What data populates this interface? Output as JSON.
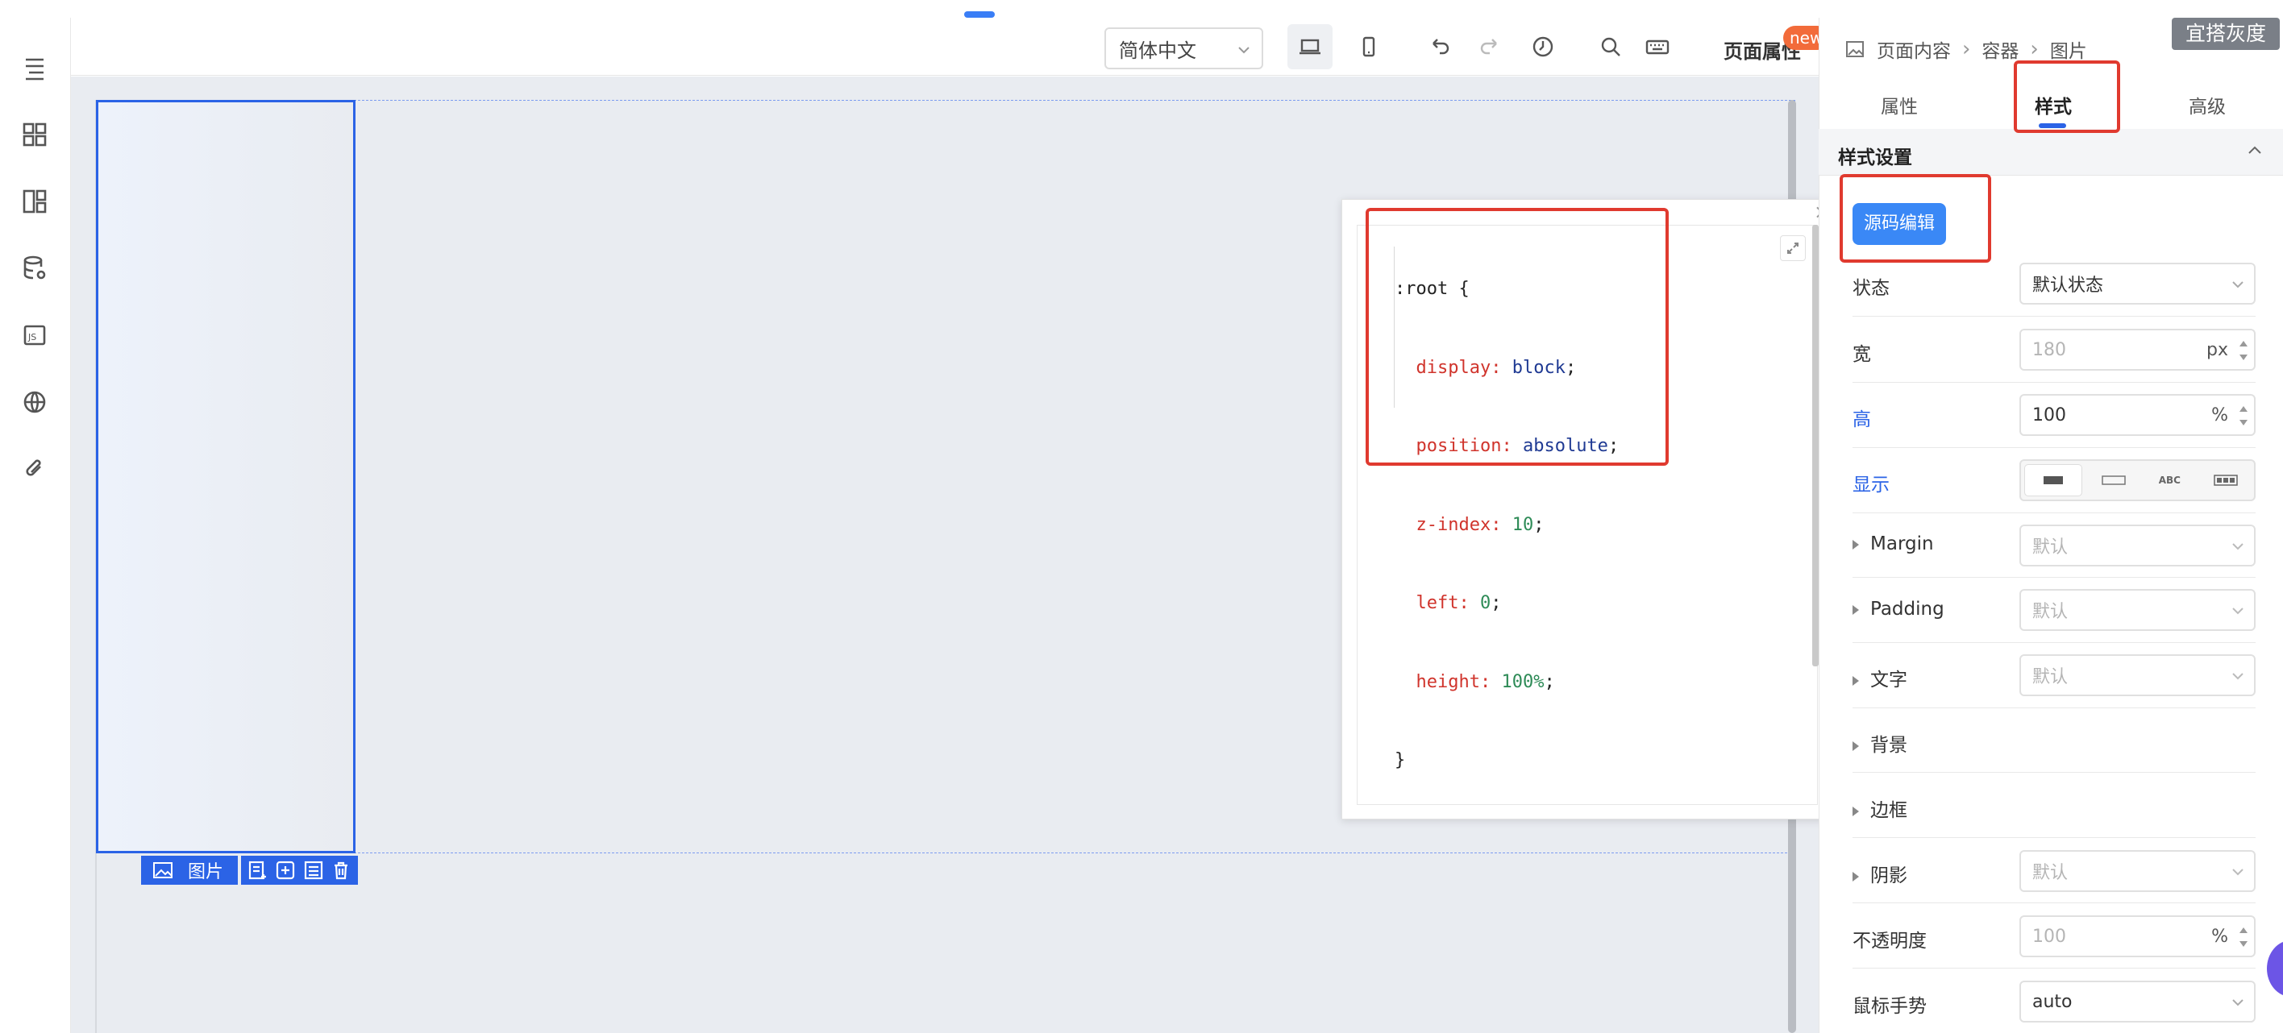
{
  "toolbar": {
    "language": "简体中文",
    "page_attr_label": "页面属性",
    "new_badge": "new"
  },
  "breadcrumb": {
    "items": [
      "页面内容",
      "容器",
      "图片"
    ]
  },
  "gray_button": "宜搭灰度",
  "tabs": {
    "props": "属性",
    "style": "样式",
    "advanced": "高级",
    "active": "样式"
  },
  "style_section": {
    "title": "样式设置",
    "source_edit": "源码编辑"
  },
  "selection": {
    "tag_label": "图片"
  },
  "code": {
    "lines": [
      {
        "k": ":root {",
        "v": "",
        "type": "open"
      },
      {
        "k": "display:",
        "v": "block",
        "type": "val"
      },
      {
        "k": "position:",
        "v": "absolute",
        "type": "val"
      },
      {
        "k": "z-index:",
        "v": "10",
        "type": "num"
      },
      {
        "k": "left:",
        "v": "0",
        "type": "num"
      },
      {
        "k": "height:",
        "v": "100%",
        "type": "num"
      },
      {
        "k": "}",
        "v": "",
        "type": "close"
      }
    ]
  },
  "fields": {
    "state_label": "状态",
    "state_value": "默认状态",
    "width_label": "宽",
    "width_placeholder": "180",
    "width_unit": "px",
    "height_label": "高",
    "height_value": "100",
    "height_unit": "%",
    "display_label": "显示",
    "display_options": [
      "",
      "ABC",
      "ABC",
      ""
    ],
    "margin_label": "Margin",
    "margin_value": "默认",
    "padding_label": "Padding",
    "padding_value": "默认",
    "text_label": "文字",
    "text_value": "默认",
    "bg_label": "背景",
    "border_label": "边框",
    "shadow_label": "阴影",
    "shadow_value": "默认",
    "opacity_label": "不透明度",
    "opacity_placeholder": "100",
    "opacity_unit": "%",
    "cursor_label": "鼠标手势",
    "cursor_value": "auto"
  },
  "colors": {
    "accent": "#2b63e6",
    "highlight": "#e03a2f",
    "button_blue": "#3a88f6"
  }
}
